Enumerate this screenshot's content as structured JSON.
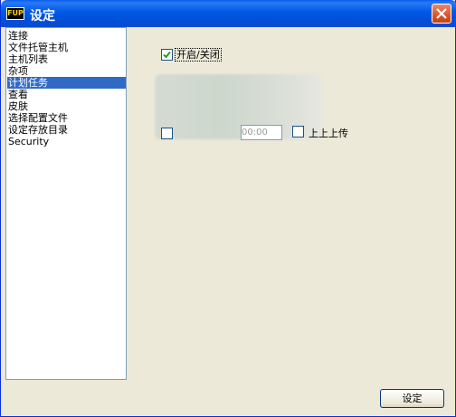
{
  "window": {
    "title": "设定",
    "app_icon_text": "FUP"
  },
  "nav": {
    "items": [
      "连接",
      "文件托管主机",
      "主机列表",
      "杂项",
      "计划任务",
      "查看",
      "皮肤",
      "选择配置文件",
      "设定存放目录",
      "Security"
    ],
    "selected_index": 4
  },
  "schedule": {
    "enable_label": "开启/关闭",
    "enable_checked": true,
    "time_value": "00:00",
    "upload_label": "上上上传"
  },
  "footer": {
    "set_button": "设定"
  }
}
